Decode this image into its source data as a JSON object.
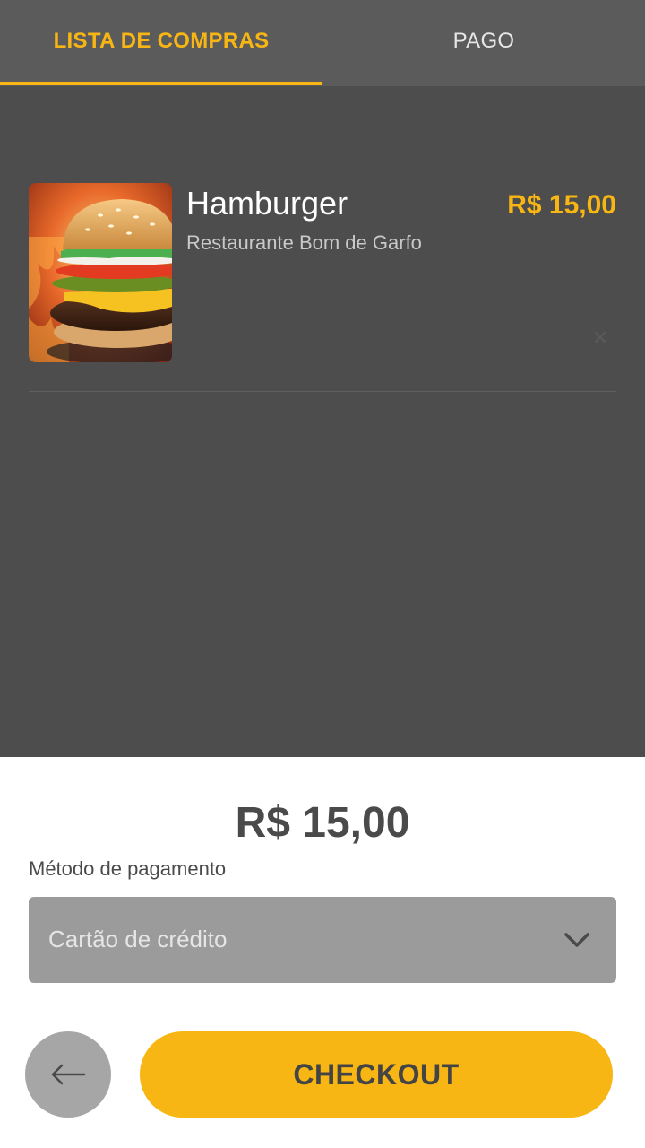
{
  "tabs": {
    "lista_label": "LISTA DE COMPRAS",
    "pago_label": "PAGO",
    "active": "LISTA DE COMPRAS"
  },
  "cart": {
    "items": [
      {
        "name": "Hamburger",
        "restaurant": "Restaurante Bom de Garfo",
        "price": "R$ 15,00",
        "image": "hamburger-photo"
      }
    ]
  },
  "summary": {
    "total": "R$ 15,00",
    "payment_label": "Método de pagamento",
    "payment_selected": "Cartão de crédito"
  },
  "actions": {
    "checkout_label": "CHECKOUT",
    "back_icon": "arrow-left-icon"
  },
  "colors": {
    "accent": "#f7b614",
    "background": "#4d4d4d",
    "tabbar": "#5b5b5b",
    "sheet": "#ffffff",
    "select": "#9b9b9b"
  }
}
